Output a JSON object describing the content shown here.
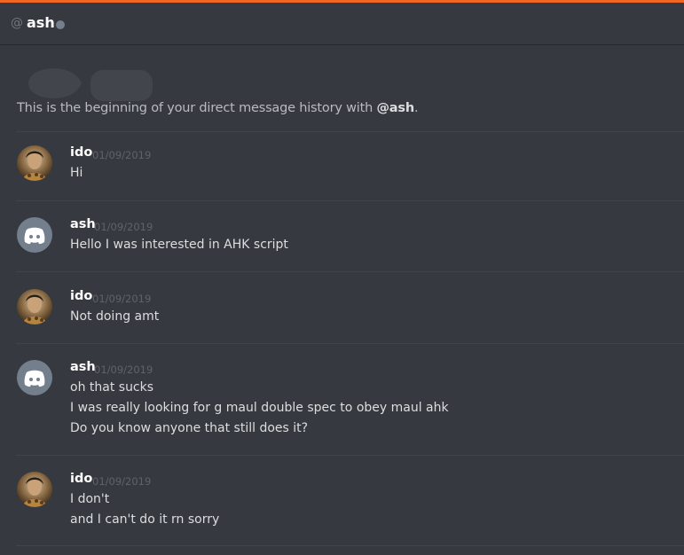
{
  "header": {
    "at_symbol": "@",
    "username": "ash",
    "accent_color": "#f26522"
  },
  "intro": {
    "prefix": "This is the beginning of your direct message history with ",
    "mention": "@ash",
    "suffix": "."
  },
  "messages": [
    {
      "author": "ido",
      "timestamp": "01/09/2019",
      "avatar": "photo",
      "lines": [
        "Hi"
      ]
    },
    {
      "author": "ash",
      "timestamp": "01/09/2019",
      "avatar": "discord-logo-icon",
      "lines": [
        "Hello I was interested in AHK script"
      ]
    },
    {
      "author": "ido",
      "timestamp": "01/09/2019",
      "avatar": "photo",
      "lines": [
        "Not doing amt"
      ]
    },
    {
      "author": "ash",
      "timestamp": "01/09/2019",
      "avatar": "discord-logo-icon",
      "lines": [
        "oh that sucks",
        "I was really looking for g maul double spec to obey maul ahk",
        "Do you know anyone that still does it?"
      ]
    },
    {
      "author": "ido",
      "timestamp": "01/09/2019",
      "avatar": "photo",
      "lines": [
        "I don't",
        "and I can't do it rn sorry"
      ]
    }
  ]
}
